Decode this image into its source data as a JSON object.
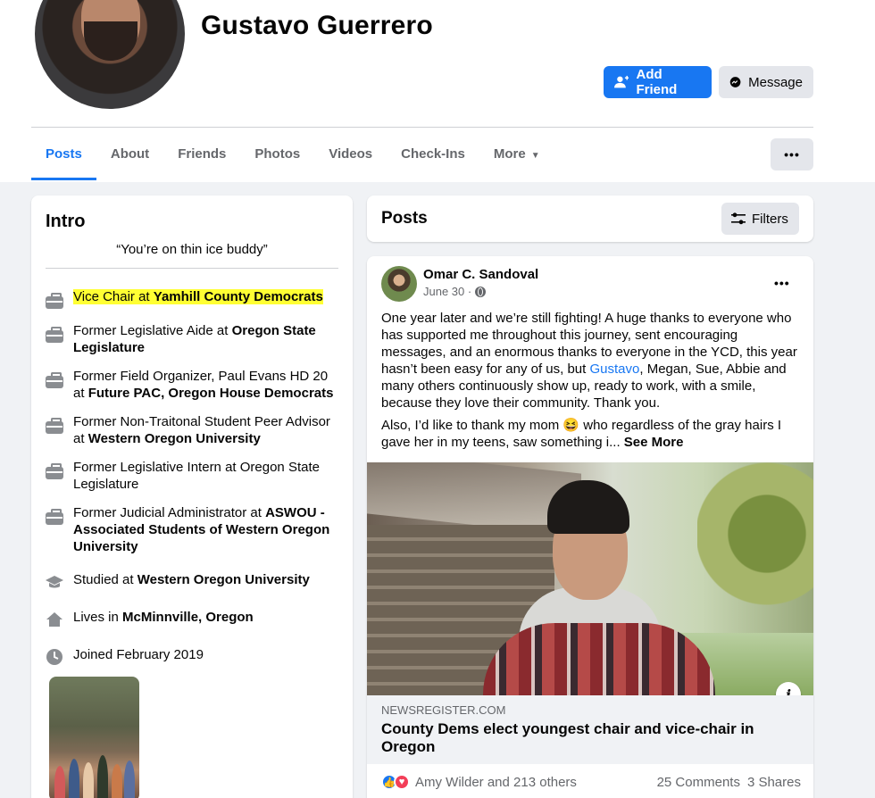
{
  "profile": {
    "name": "Gustavo Guerrero",
    "add_friend_label": "Add Friend",
    "message_label": "Message"
  },
  "tabs": [
    {
      "label": "Posts"
    },
    {
      "label": "About"
    },
    {
      "label": "Friends"
    },
    {
      "label": "Photos"
    },
    {
      "label": "Videos"
    },
    {
      "label": "Check-Ins"
    },
    {
      "label": "More"
    }
  ],
  "intro": {
    "title": "Intro",
    "bio": "“You’re on thin ice buddy”",
    "items": [
      {
        "icon": "briefcase-icon",
        "pre": "Vice Chair at ",
        "bold": "Yamhill County Democrats",
        "post": ""
      },
      {
        "icon": "briefcase-icon",
        "pre": "Former Legislative Aide at ",
        "bold": "Oregon State Legislature",
        "post": ""
      },
      {
        "icon": "briefcase-icon",
        "pre": "Former Field Organizer, Paul Evans HD 20 at ",
        "bold": "Future PAC, Oregon House Democrats",
        "post": ""
      },
      {
        "icon": "briefcase-icon",
        "pre": "Former Non-Traitonal Student Peer Advisor at ",
        "bold": "Western Oregon University",
        "post": ""
      },
      {
        "icon": "briefcase-icon",
        "pre": "Former Legislative Intern at Oregon State Legislature",
        "bold": "",
        "post": ""
      },
      {
        "icon": "briefcase-icon",
        "pre": "Former Judicial Administrator at ",
        "bold": "ASWOU - Associated Students of Western Oregon University",
        "post": ""
      },
      {
        "icon": "graduation-cap-icon",
        "pre": "Studied at ",
        "bold": "Western Oregon University",
        "post": ""
      },
      {
        "icon": "home-icon",
        "pre": "Lives in ",
        "bold": "McMinnville, Oregon",
        "post": ""
      },
      {
        "icon": "clock-icon",
        "pre": "Joined February 2019",
        "bold": "",
        "post": ""
      }
    ]
  },
  "posts_header": {
    "title": "Posts",
    "filters_label": "Filters"
  },
  "post": {
    "author": "Omar C. Sandoval",
    "date": "June 30 ·",
    "body_1_pre": "One year later and we’re still fighting! A huge thanks to everyone who has supported me throughout this journey, sent encouraging messages, and an enormous thanks to everyone in the YCD, this year hasn’t been easy for any of us, but ",
    "body_1_link": "Gustavo",
    "body_1_post": ", Megan, Sue, Abbie and many others continuously show up, ready to work, with a smile, because they love their community. Thank you.",
    "body_2_pre": "Also, I’d like to thank my mom 😆 who regardless of the gray hairs I gave her in my teens, saw something i... ",
    "see_more": "See More",
    "link_domain": "NEWSREGISTER.COM",
    "link_title": "County Dems elect youngest chair and vice-chair in Oregon",
    "reactions_text": "Amy Wilder and 213 others",
    "comments": "25 Comments",
    "shares": "3 Shares"
  },
  "colors": {
    "accent": "#1877f2",
    "highlight": "#ffff33",
    "page_bg": "#f0f2f5"
  }
}
